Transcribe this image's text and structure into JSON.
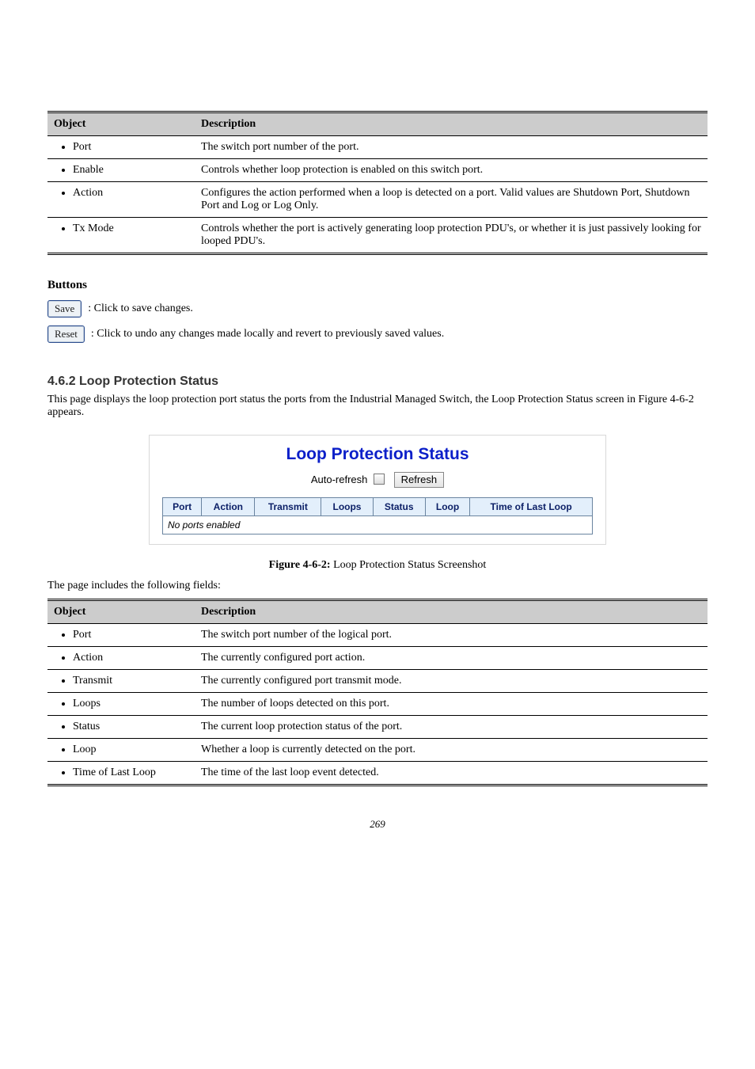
{
  "table1": {
    "headers": {
      "obj": "Object",
      "desc": "Description"
    },
    "rows": [
      {
        "obj": "Port",
        "desc": "The switch port number of the port."
      },
      {
        "obj": "Enable",
        "desc": "Controls whether loop protection is enabled on this switch port."
      },
      {
        "obj": "Action",
        "desc": "Configures the action performed when a loop is detected on a port. Valid values are Shutdown Port, Shutdown Port and Log or Log Only."
      },
      {
        "obj": "Tx Mode",
        "desc": "Controls whether the port is actively generating loop protection PDU's, or whether it is just passively looking for looped PDU's."
      }
    ]
  },
  "buttons": {
    "intro": "Buttons",
    "save": {
      "label": "Save",
      "desc": ": Click to save changes."
    },
    "reset": {
      "label": "Reset",
      "desc": ": Click to undo any changes made locally and revert to previously saved values."
    }
  },
  "section": {
    "heading": "4.6.2 Loop Protection Status",
    "sub_pre": "This page displays the loop protection port status the ports from the Industrial Managed Switch, the Loop Protection Status screen in ",
    "sub_link": "Figure 4-6-2",
    "sub_post": " appears."
  },
  "figure": {
    "title": "Loop Protection Status",
    "autorefresh_label": "Auto-refresh",
    "refresh_label": "Refresh",
    "columns": [
      "Port",
      "Action",
      "Transmit",
      "Loops",
      "Status",
      "Loop",
      "Time of Last Loop"
    ],
    "empty_row": "No ports enabled",
    "caption_pre": "Figure 4-6-2:",
    "caption_post": " Loop Protection Status Screenshot"
  },
  "table2": {
    "intro": "The page includes the following fields:",
    "headers": {
      "obj": "Object",
      "desc": "Description"
    },
    "rows": [
      {
        "obj": "Port",
        "desc": "The switch port number of the logical port."
      },
      {
        "obj": "Action",
        "desc": "The currently configured port action."
      },
      {
        "obj": "Transmit",
        "desc": "The currently configured port transmit mode."
      },
      {
        "obj": "Loops",
        "desc": "The number of loops detected on this port."
      },
      {
        "obj": "Status",
        "desc": "The current loop protection status of the port."
      },
      {
        "obj": "Loop",
        "desc": "Whether a loop is currently detected on the port."
      },
      {
        "obj": "Time of Last Loop",
        "desc": "The time of the last loop event detected."
      }
    ]
  },
  "footer": "269"
}
